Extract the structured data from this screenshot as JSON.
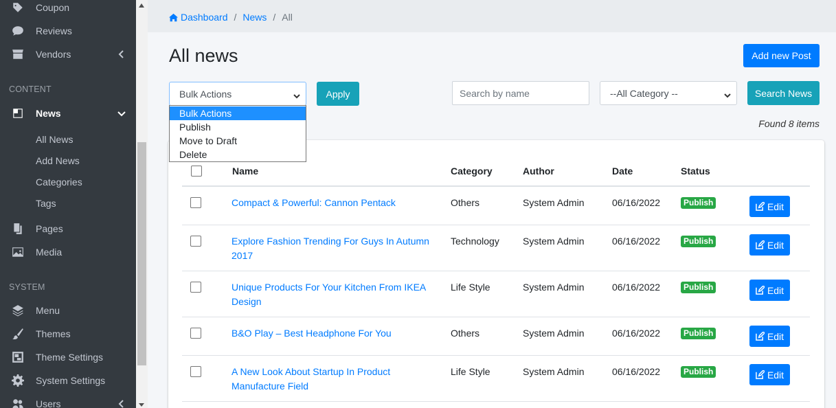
{
  "sidebar": {
    "items_top": [
      {
        "label": "Coupon",
        "icon": "coupon-icon"
      },
      {
        "label": "Reviews",
        "icon": "comment-icon"
      },
      {
        "label": "Vendors",
        "icon": "store-icon"
      }
    ],
    "section_content": "CONTENT",
    "news_label": "News",
    "news_children": [
      "All News",
      "Add News",
      "Categories",
      "Tags"
    ],
    "pages_label": "Pages",
    "media_label": "Media",
    "section_system": "SYSTEM",
    "system_items": [
      "Menu",
      "Themes",
      "Theme Settings",
      "System Settings",
      "Users"
    ]
  },
  "breadcrumb": {
    "home": "Dashboard",
    "news": "News",
    "current": "All"
  },
  "page": {
    "title": "All news",
    "add_button": "Add new Post",
    "apply_button": "Apply",
    "search_placeholder": "Search by name",
    "category_select": "--All Category --",
    "search_button": "Search News",
    "found_text": "Found 8 items"
  },
  "bulk": {
    "selected": "Bulk Actions",
    "options": [
      "Bulk Actions",
      "Publish",
      "Move to Draft",
      "Delete"
    ]
  },
  "table": {
    "headers": {
      "name": "Name",
      "category": "Category",
      "author": "Author",
      "date": "Date",
      "status": "Status"
    },
    "rows": [
      {
        "name": "Compact & Powerful: Cannon Pentack",
        "category": "Others",
        "author": "System Admin",
        "date": "06/16/2022",
        "status": "Publish",
        "edit": "Edit"
      },
      {
        "name": "Explore Fashion Trending For Guys In Autumn 2017",
        "category": "Technology",
        "author": "System Admin",
        "date": "06/16/2022",
        "status": "Publish",
        "edit": "Edit"
      },
      {
        "name": "Unique Products For Your Kitchen From IKEA Design",
        "category": "Life Style",
        "author": "System Admin",
        "date": "06/16/2022",
        "status": "Publish",
        "edit": "Edit"
      },
      {
        "name": "B&O Play – Best Headphone For You",
        "category": "Others",
        "author": "System Admin",
        "date": "06/16/2022",
        "status": "Publish",
        "edit": "Edit"
      },
      {
        "name": "A New Look About Startup In Product Manufacture Field",
        "category": "Life Style",
        "author": "System Admin",
        "date": "06/16/2022",
        "status": "Publish",
        "edit": "Edit"
      }
    ]
  },
  "colors": {
    "sidebar_bg": "#343a40",
    "primary": "#007bff",
    "info": "#17a2b8",
    "success": "#28a745"
  }
}
